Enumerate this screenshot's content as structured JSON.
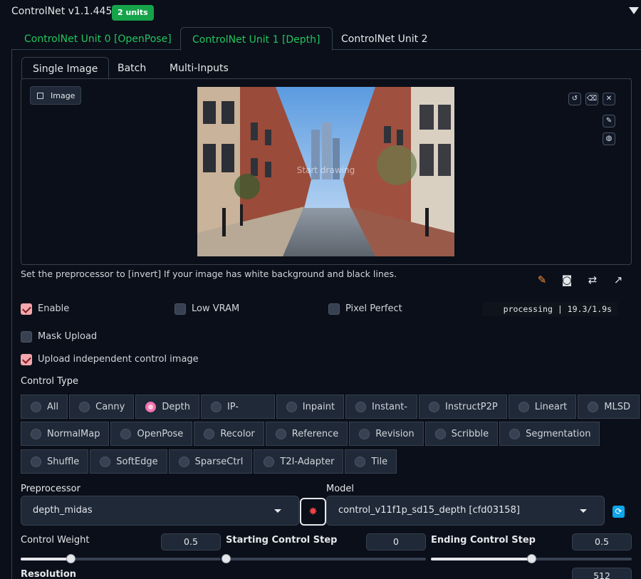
{
  "header": {
    "title": "ControlNet v1.1.445",
    "badge": "2 units"
  },
  "unit_tabs": [
    {
      "label": "ControlNet Unit 0 [OpenPose]",
      "active": false
    },
    {
      "label": "ControlNet Unit 1 [Depth]",
      "active": true
    },
    {
      "label": "ControlNet Unit 2",
      "active": false
    }
  ],
  "sub_tabs": [
    {
      "label": "Single Image",
      "active": true
    },
    {
      "label": "Batch",
      "active": false
    },
    {
      "label": "Multi-Inputs",
      "active": false
    }
  ],
  "image": {
    "label": "Image",
    "overlay": "Start drawing"
  },
  "image_buttons": [
    "undo-icon",
    "eraser-icon",
    "close-icon",
    "brush-icon",
    "palette-icon"
  ],
  "hint": "Set the preprocessor to [invert] If your image has white background and black lines.",
  "tools": [
    "edit-icon",
    "camera-icon",
    "swap-icon",
    "send-icon"
  ],
  "options": {
    "enable": {
      "label": "Enable",
      "checked": true
    },
    "low_vram": {
      "label": "Low VRAM",
      "checked": false
    },
    "pixel_perfect": {
      "label": "Pixel Perfect",
      "checked": false
    },
    "mask_upload": {
      "label": "Mask Upload",
      "checked": false
    },
    "upload_independent": {
      "label": "Upload independent control image",
      "checked": true
    }
  },
  "processing": {
    "label": "processing",
    "time": "| 19.3/1.9s"
  },
  "control_type": {
    "label": "Control Type",
    "selected": "Depth",
    "rows": [
      [
        "All",
        "Canny",
        "Depth",
        "IP-Adapter",
        "Inpaint",
        "Instant-ID",
        "InstructP2P",
        "Lineart",
        "MLSD"
      ],
      [
        "NormalMap",
        "OpenPose",
        "Recolor",
        "Reference",
        "Revision",
        "Scribble",
        "Segmentation"
      ],
      [
        "Shuffle",
        "SoftEdge",
        "SparseCtrl",
        "T2I-Adapter",
        "Tile"
      ]
    ]
  },
  "preprocessor": {
    "label": "Preprocessor",
    "value": "depth_midas"
  },
  "model": {
    "label": "Model",
    "value": "control_v11f1p_sd15_depth [cfd03158]"
  },
  "control_weight": {
    "label": "Control Weight",
    "value": "0.5",
    "fraction": 0.25
  },
  "starting_step": {
    "label": "Starting Control Step",
    "value": "0",
    "fraction": 0.0
  },
  "ending_step": {
    "label": "Ending Control Step",
    "value": "0.5",
    "fraction": 0.5
  },
  "resolution": {
    "label": "Resolution",
    "value": "512"
  },
  "colors": {
    "accent_green": "#22c55e",
    "badge_green": "#16a34a",
    "checked_pink": "#f4a7ae"
  }
}
